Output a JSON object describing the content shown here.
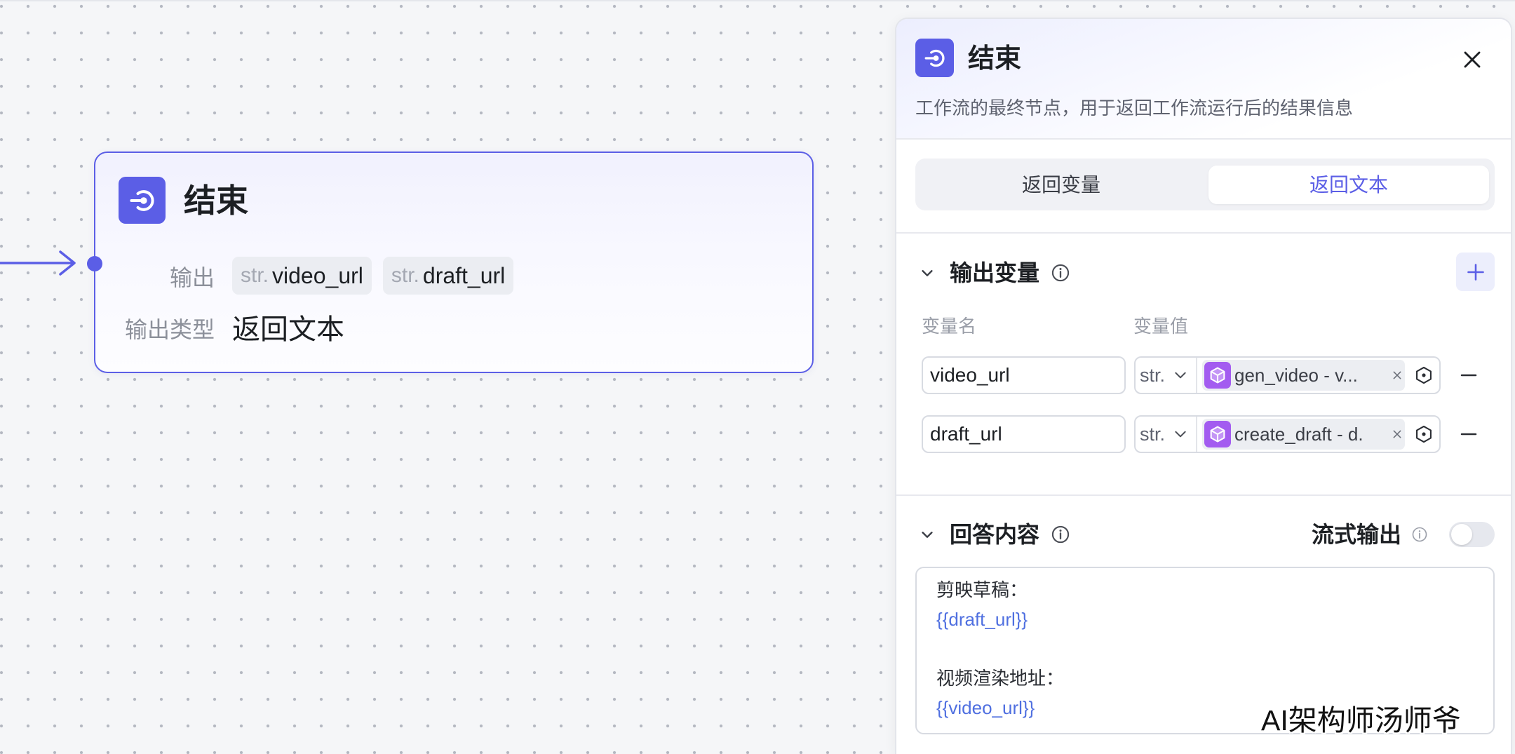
{
  "colors": {
    "accent": "#5b5ee6",
    "variable_text": "#4f6fe0",
    "node_icon_cube": "#a35cf0"
  },
  "icons": {
    "end_node": "end-node-icon",
    "close": "close-icon",
    "collapse": "chevron-down-icon",
    "info": "info-icon",
    "add": "plus-icon",
    "remove": "minus-icon",
    "plugin": "cube-icon",
    "variable_picker": "variable-hex-icon",
    "clear": "clear-x-icon"
  },
  "node": {
    "title": "结束",
    "output_label": "输出",
    "outputs": [
      {
        "type": "str.",
        "name": "video_url"
      },
      {
        "type": "str.",
        "name": "draft_url"
      }
    ],
    "output_type_label": "输出类型",
    "output_type_value": "返回文本"
  },
  "panel": {
    "title": "结束",
    "description": "工作流的最终节点，用于返回工作流运行后的结果信息",
    "tabs": [
      {
        "label": "返回变量",
        "active": false
      },
      {
        "label": "返回文本",
        "active": true
      }
    ],
    "output_vars": {
      "title": "输出变量",
      "col_name": "变量名",
      "col_value": "变量值",
      "rows": [
        {
          "name": "video_url",
          "type": "str.",
          "ref": "gen_video - v..."
        },
        {
          "name": "draft_url",
          "type": "str.",
          "ref": "create_draft - d."
        }
      ]
    },
    "answer": {
      "title": "回答内容",
      "streaming_label": "流式输出",
      "streaming_enabled": false,
      "blocks": [
        {
          "label": "剪映草稿：",
          "var": "{{draft_url}}"
        },
        {
          "label": "视频渲染地址：",
          "var": "{{video_url}}"
        }
      ]
    }
  },
  "watermark": "AI架构师汤师爷"
}
